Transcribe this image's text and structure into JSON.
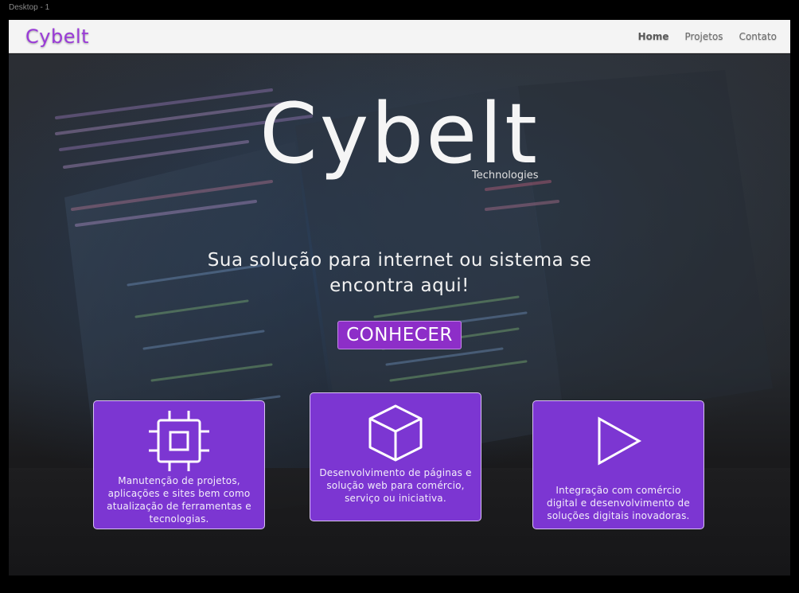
{
  "frame": {
    "label": "Desktop - 1"
  },
  "header": {
    "brand": "Cybelt",
    "nav": [
      {
        "label": "Home",
        "active": true
      },
      {
        "label": "Projetos",
        "active": false
      },
      {
        "label": "Contato",
        "active": false
      }
    ]
  },
  "hero": {
    "title": "Cybelt",
    "subtitle": "Technologies",
    "tagline": "Sua solução para internet ou sistema se encontra aqui!",
    "cta_label": "CONHECER"
  },
  "cards": [
    {
      "icon": "cpu-chip-icon",
      "text": "Manutenção de projetos, aplicações e sites bem como atualização de ferramentas e tecnologias."
    },
    {
      "icon": "cube-box-icon",
      "text": "Desenvolvimento de páginas e solução  web para comércio, serviço ou iniciativa."
    },
    {
      "icon": "play-triangle-icon",
      "text": "Integração com comércio digital e desenvolvimento de soluções digitais inovadoras."
    }
  ],
  "colors": {
    "brand_purple": "#9a3ad8",
    "card_purple": "#7c36d2",
    "button_purple": "#8d2ec8",
    "nav_background": "#f4f4f4"
  }
}
